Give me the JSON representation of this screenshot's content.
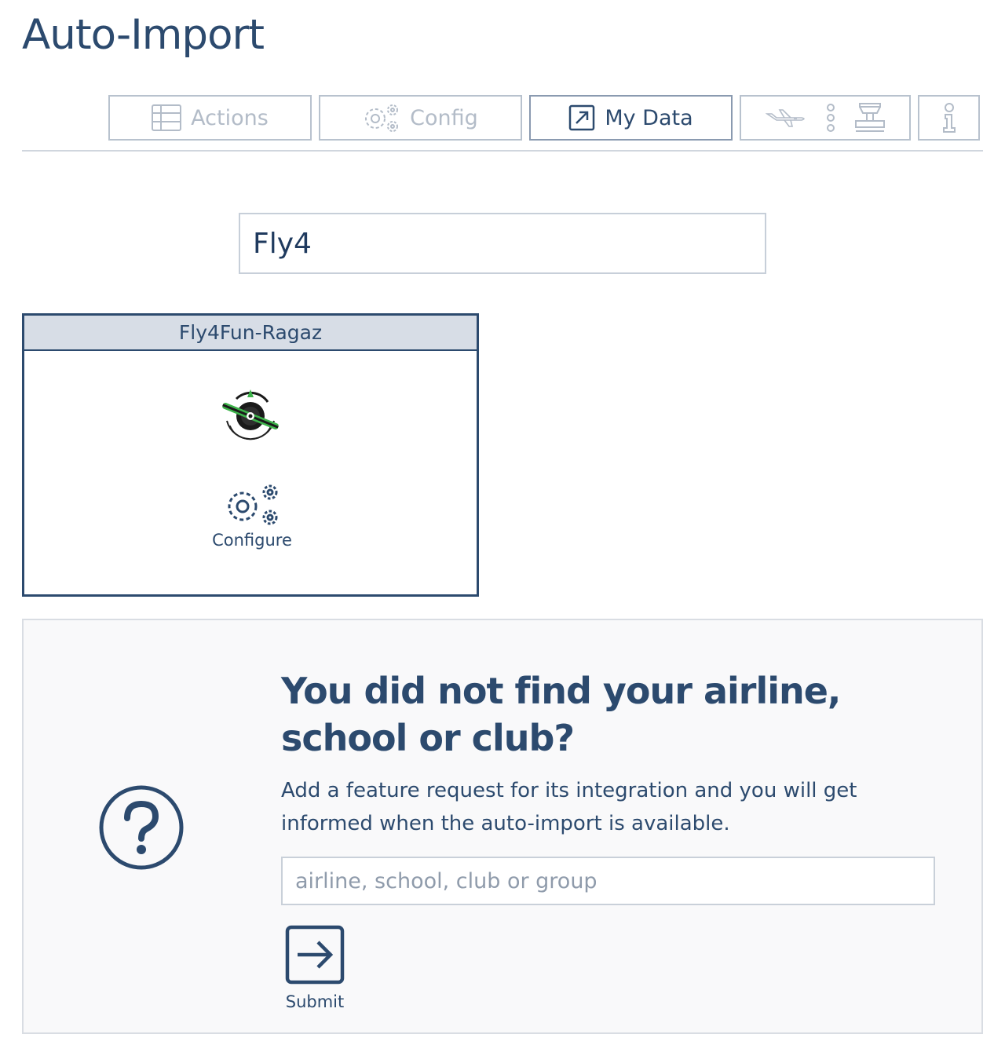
{
  "page": {
    "title": "Auto-Import"
  },
  "tabs": [
    {
      "label": "Actions",
      "icon": "table-icon",
      "active": false
    },
    {
      "label": "Config",
      "icon": "gears-icon",
      "active": false
    },
    {
      "label": "My Data",
      "icon": "external-link-icon",
      "active": true
    },
    {
      "label": "",
      "icon": "airplane-more-tower-icon",
      "active": false
    },
    {
      "label": "",
      "icon": "info-icon",
      "active": false
    }
  ],
  "search": {
    "value": "Fly4"
  },
  "result_card": {
    "name": "Fly4Fun-Ragaz",
    "logo": "fly4fun-logo",
    "configure_label": "Configure",
    "configure_icon": "gears-icon"
  },
  "request": {
    "title": "You did not find your airline, school or club?",
    "text": "Add a feature request for its integration and you will get informed when the auto-import is available.",
    "input_placeholder": "airline, school, club or group",
    "input_value": "",
    "submit_label": "Submit",
    "icon": "question-circle-icon"
  },
  "colors": {
    "primary": "#2c4a6e",
    "muted": "#b3bcc8",
    "card_header": "#d7dde6",
    "panel_bg": "#f9f9fa",
    "logo_green": "#3db34a"
  }
}
